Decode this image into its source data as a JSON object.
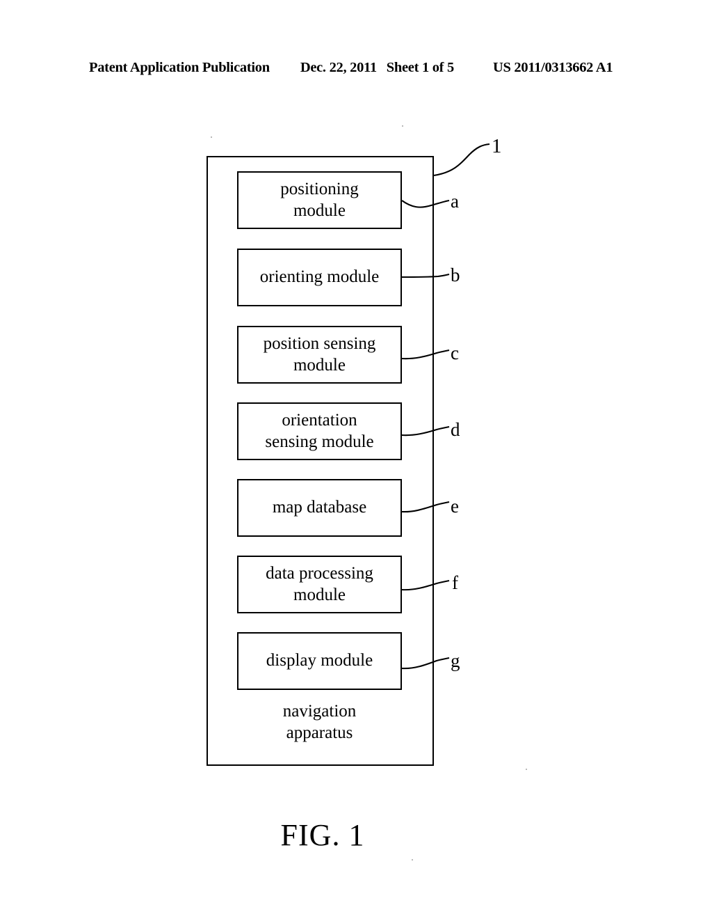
{
  "header": {
    "publication": "Patent Application Publication",
    "date": "Dec. 22, 2011",
    "sheet": "Sheet 1 of 5",
    "publication_number": "US 2011/0313662 A1"
  },
  "figure": {
    "caption": "FIG. 1",
    "container": {
      "caption": "navigation\napparatus",
      "reference": "1"
    },
    "modules": [
      {
        "label": "positioning\nmodule",
        "reference": "a"
      },
      {
        "label": "orienting module",
        "reference": "b"
      },
      {
        "label": "position sensing\nmodule",
        "reference": "c"
      },
      {
        "label": "orientation\nsensing module",
        "reference": "d"
      },
      {
        "label": "map database",
        "reference": "e"
      },
      {
        "label": "data processing\nmodule",
        "reference": "f"
      },
      {
        "label": "display module",
        "reference": "g"
      }
    ]
  },
  "colors": {
    "ink": "#000000",
    "paper": "#ffffff"
  }
}
